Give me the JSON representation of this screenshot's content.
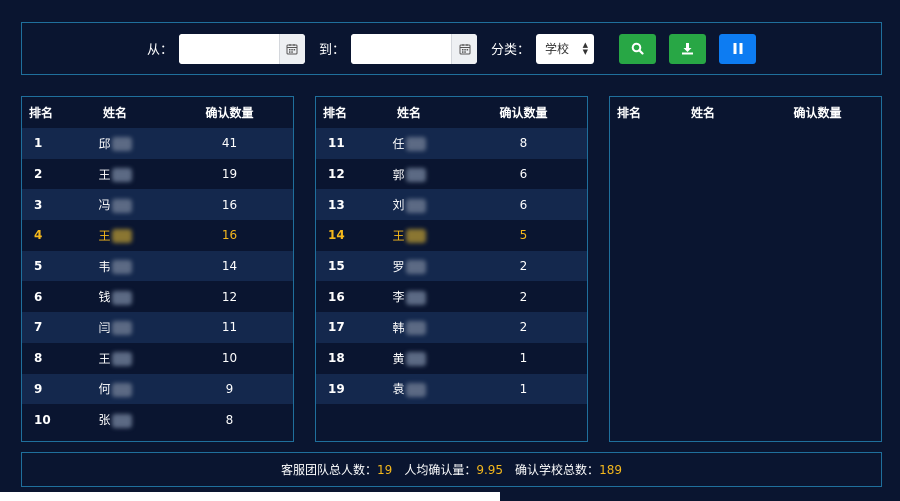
{
  "toolbar": {
    "from_label": "从：",
    "to_label": "到：",
    "category_label": "分类：",
    "from_value": "",
    "to_value": "",
    "category_value": "学校"
  },
  "tables": [
    {
      "headers": {
        "rank": "排名",
        "name": "姓名",
        "count": "确认数量"
      },
      "rows": [
        {
          "rank": "1",
          "name": "邱",
          "count": "41",
          "highlight": false
        },
        {
          "rank": "2",
          "name": "王",
          "count": "19",
          "highlight": false
        },
        {
          "rank": "3",
          "name": "冯",
          "count": "16",
          "highlight": false
        },
        {
          "rank": "4",
          "name": "王",
          "count": "16",
          "highlight": true
        },
        {
          "rank": "5",
          "name": "韦",
          "count": "14",
          "highlight": false
        },
        {
          "rank": "6",
          "name": "钱",
          "count": "12",
          "highlight": false
        },
        {
          "rank": "7",
          "name": "闫",
          "count": "11",
          "highlight": false
        },
        {
          "rank": "8",
          "name": "王",
          "count": "10",
          "highlight": false
        },
        {
          "rank": "9",
          "name": "何",
          "count": "9",
          "highlight": false
        },
        {
          "rank": "10",
          "name": "张",
          "count": "8",
          "highlight": false
        }
      ]
    },
    {
      "headers": {
        "rank": "排名",
        "name": "姓名",
        "count": "确认数量"
      },
      "rows": [
        {
          "rank": "11",
          "name": "任",
          "count": "8",
          "highlight": false
        },
        {
          "rank": "12",
          "name": "郭",
          "count": "6",
          "highlight": false
        },
        {
          "rank": "13",
          "name": "刘",
          "count": "6",
          "highlight": false
        },
        {
          "rank": "14",
          "name": "王",
          "count": "5",
          "highlight": true
        },
        {
          "rank": "15",
          "name": "罗",
          "count": "2",
          "highlight": false
        },
        {
          "rank": "16",
          "name": "李",
          "count": "2",
          "highlight": false
        },
        {
          "rank": "17",
          "name": "韩",
          "count": "2",
          "highlight": false
        },
        {
          "rank": "18",
          "name": "黄",
          "count": "1",
          "highlight": false
        },
        {
          "rank": "19",
          "name": "袁",
          "count": "1",
          "highlight": false
        }
      ]
    },
    {
      "headers": {
        "rank": "排名",
        "name": "姓名",
        "count": "确认数量"
      },
      "rows": []
    }
  ],
  "footer": {
    "team_total_label": "客服团队总人数：",
    "team_total_value": "19",
    "avg_label": "人均确认量：",
    "avg_value": "9.95",
    "school_total_label": "确认学校总数：",
    "school_total_value": "189"
  },
  "colors": {
    "background": "#0a1530",
    "border": "#1f6f9c",
    "highlight": "#f5b81c",
    "row_alt": "#14284d",
    "search_button": "#28a745",
    "export_button": "#28a745",
    "pause_button": "#0d7cf2"
  },
  "icons": {
    "calendar": "calendar-icon",
    "search": "search-icon",
    "download": "download-icon",
    "pause": "pause-icon"
  }
}
